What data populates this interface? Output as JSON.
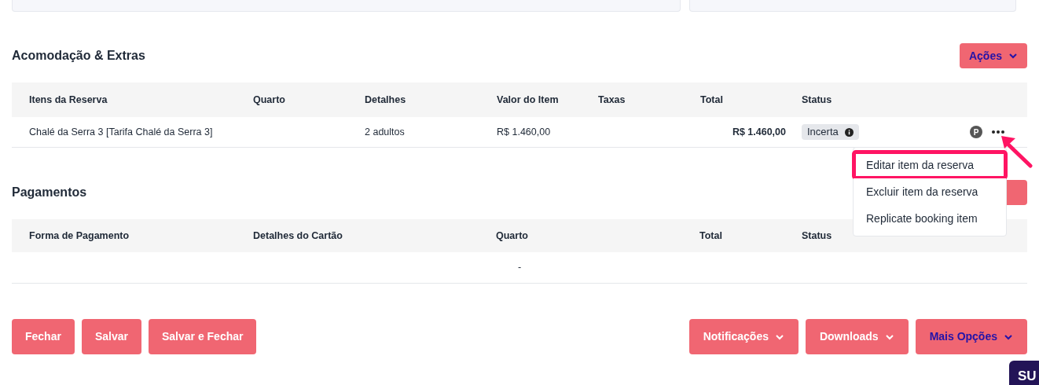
{
  "accommodation": {
    "title": "Acomodação & Extras",
    "actions_button": "Ações",
    "table": {
      "columns": [
        "Itens da Reserva",
        "Quarto",
        "Detalhes",
        "Valor do Item",
        "Taxas",
        "Total",
        "Status"
      ],
      "rows": [
        {
          "item": "Chalé da Serra 3 [Tarifa Chalé da Serra 3]",
          "room": "",
          "details": "2 adultos",
          "value": "R$ 1.460,00",
          "taxes": "",
          "total": "R$ 1.460,00",
          "status": "Incerta",
          "badge": "P"
        }
      ]
    },
    "row_menu": {
      "open": true,
      "items": [
        {
          "label": "Editar item da reserva",
          "highlighted": true
        },
        {
          "label": "Excluir item da reserva",
          "highlighted": false
        },
        {
          "label": "Replicate booking item",
          "highlighted": false
        }
      ]
    }
  },
  "payments": {
    "title": "Pagamentos",
    "table": {
      "columns": [
        "Forma de Pagamento",
        "Detalhes do Cartão",
        "Quarto",
        "Total",
        "Status"
      ],
      "empty_text": "-"
    }
  },
  "footer": {
    "left_buttons": [
      "Fechar",
      "Salvar",
      "Salvar e Fechar"
    ],
    "right_buttons": [
      {
        "label": "Notificações",
        "accent": false
      },
      {
        "label": "Downloads",
        "accent": false
      },
      {
        "label": "Mais Opções",
        "accent": true
      }
    ],
    "corner_tab": "SU"
  }
}
